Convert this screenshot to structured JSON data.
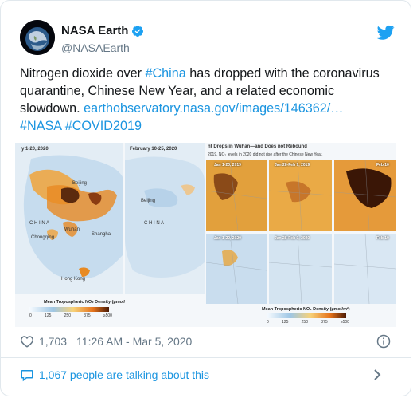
{
  "tweet": {
    "author": {
      "display_name": "NASA Earth",
      "handle": "@NASAEarth",
      "verified": true
    },
    "text": {
      "line1_pre": "Nitrogen dioxide over ",
      "line1_hashtag": "#China",
      "line1_post": " has dropped with the coronavirus",
      "line2": "quarantine, Chinese New Year, and a related economic",
      "line3_pre": "slowdown. ",
      "line3_link": "earthobservatory.nasa.gov/images/146362/…",
      "line4_hashtag1": "#NASA",
      "line4_hashtag2": "#COVID2019"
    },
    "likes": "1,703",
    "timestamp": "11:26 AM - Mar 5, 2020",
    "talking": "1,067 people are talking about this"
  },
  "media": {
    "map1": {
      "date": "y 1-20, 2020",
      "country": "C H I N A",
      "cities": [
        "Beijing",
        "Wuhan",
        "Chongqing",
        "Shanghai",
        "Hong Kong"
      ]
    },
    "map2": {
      "date": "February 10-25, 2020",
      "country": "C H I N A",
      "cities": [
        "Beijing"
      ]
    },
    "map3": {
      "title": "nt Drops in Wuhan—and Does not Rebound",
      "subtitle": "2019, NO₂ levels in 2020 did not rise after the Chinese New Year.",
      "cells": [
        "Jan 1-20, 2019",
        "Jan 28-Feb 9, 2019",
        "Feb 10",
        "Jan 1-20, 2020",
        "Jan 28-Feb 9, 2020",
        "Feb 10"
      ]
    },
    "legend": {
      "title": "Mean Tropospheric NO₂ Density (μmol/m²)",
      "ticks": [
        "0",
        "125",
        "250",
        "375",
        "≥500"
      ]
    }
  },
  "colors": {
    "text": "#14171a",
    "secondary": "#657786",
    "link": "#1b95e0",
    "twitter_blue": "#1da1f2",
    "border": "#e1e8ed"
  },
  "icons": [
    "nasa-earth-avatar",
    "verified-badge-icon",
    "twitter-bird-icon",
    "heart-icon",
    "info-icon",
    "speech-bubble-icon",
    "chevron-right-icon"
  ]
}
